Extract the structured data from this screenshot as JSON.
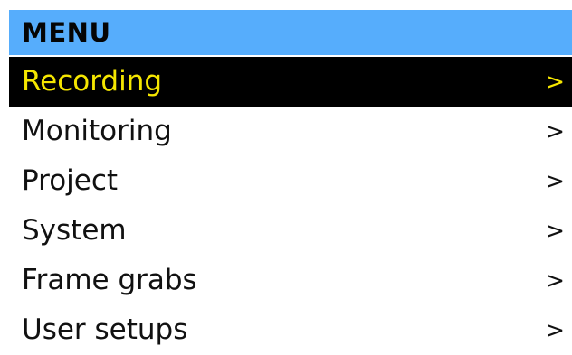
{
  "menu": {
    "title": "MENU",
    "selected_index": 0,
    "colors": {
      "header_bg": "#56adfc",
      "selected_bg": "#000000",
      "selected_text": "#f5e600",
      "text": "#111111",
      "bg": "#ffffff"
    },
    "items": [
      {
        "label": "Recording",
        "chevron": ">"
      },
      {
        "label": "Monitoring",
        "chevron": ">"
      },
      {
        "label": "Project",
        "chevron": ">"
      },
      {
        "label": "System",
        "chevron": ">"
      },
      {
        "label": "Frame grabs",
        "chevron": ">"
      },
      {
        "label": "User setups",
        "chevron": ">"
      }
    ]
  }
}
